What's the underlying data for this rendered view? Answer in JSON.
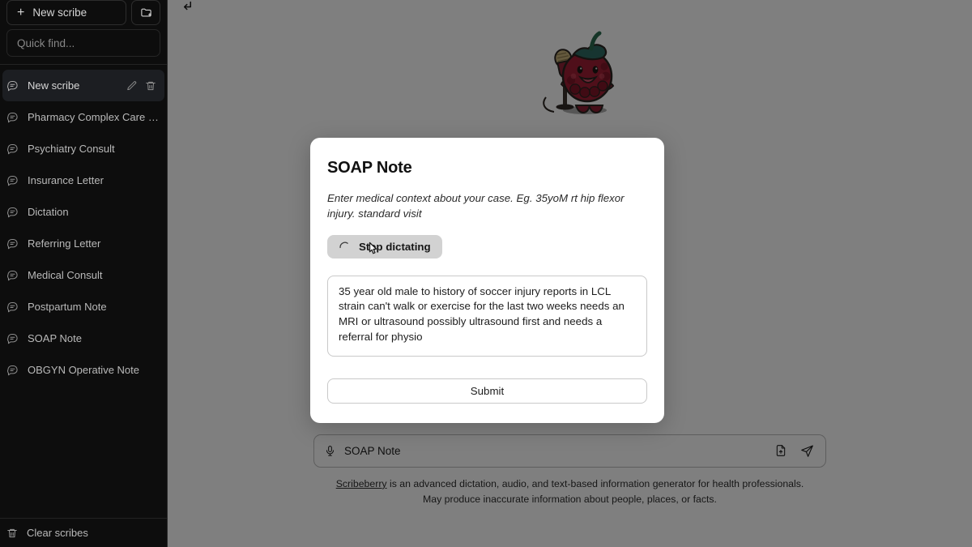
{
  "sidebar": {
    "new_scribe_label": "New scribe",
    "new_folder_icon": "folder-plus-icon",
    "search_placeholder": "Quick find...",
    "items": [
      {
        "label": "New scribe",
        "active": true
      },
      {
        "label": "Pharmacy Complex Care Plan",
        "active": false
      },
      {
        "label": "Psychiatry Consult",
        "active": false
      },
      {
        "label": "Insurance Letter",
        "active": false
      },
      {
        "label": "Dictation",
        "active": false
      },
      {
        "label": "Referring Letter",
        "active": false
      },
      {
        "label": "Medical Consult",
        "active": false
      },
      {
        "label": "Postpartum Note",
        "active": false
      },
      {
        "label": "SOAP Note",
        "active": false
      },
      {
        "label": "OBGYN Operative Note",
        "active": false
      }
    ],
    "clear_label": "Clear scribes"
  },
  "main": {
    "back_icon": "back-arrow-icon",
    "mascot_alt": "raspberry-mascot-with-microphone",
    "composer": {
      "mic_icon": "microphone-icon",
      "value": "SOAP Note",
      "attach_icon": "file-upload-icon",
      "send_icon": "send-icon"
    },
    "footer": {
      "brand": "Scribeberry",
      "line1_rest": " is an advanced dictation, audio, and text-based information generator for health professionals.",
      "line2": "May produce inaccurate information about people, places, or facts."
    }
  },
  "modal": {
    "title": "SOAP Note",
    "subtitle": "Enter medical context about your case. Eg. 35yoM rt hip flexor injury. standard visit",
    "dictate_label": "Stop dictating",
    "dictate_state": "recording",
    "context_value": "35 year old male to history of soccer injury reports in LCL strain can't walk or exercise for the last two weeks needs an MRI or ultrasound possibly ultrasound first and needs a referral for physio",
    "submit_label": "Submit"
  },
  "colors": {
    "sidebar_bg": "#0d0d0d",
    "overlay": "#808080",
    "modal_bg": "#ffffff",
    "button_bg": "#d2d2d2",
    "accent_text": "#b9b9b9"
  }
}
